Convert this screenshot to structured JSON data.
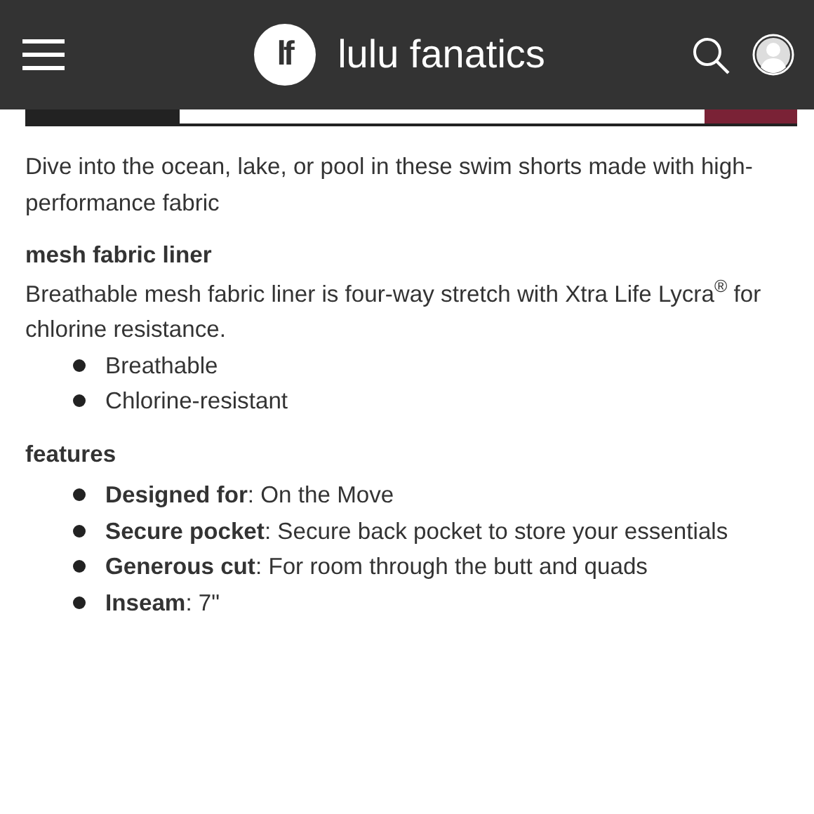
{
  "header": {
    "logo_mark": "lf",
    "brand": "lulu fanatics"
  },
  "intro": "Dive into the ocean, lake, or pool in these swim shorts made with high-performance fabric",
  "sections": [
    {
      "heading": "mesh fabric liner",
      "text": "Breathable mesh fabric liner is four-way stretch with Xtra Life Lycra$^{®}$ for chlorine resistance.",
      "bullets": [
        "Breathable",
        "Chlorine-resistant"
      ]
    },
    {
      "heading": "features",
      "bullets": [
        "**Designed for**: On the Move",
        "**Secure pocket**: Secure back pocket to store your essentials",
        "**Generous cut**: For room through the butt and quads",
        "**Inseam**: 7\""
      ]
    }
  ]
}
